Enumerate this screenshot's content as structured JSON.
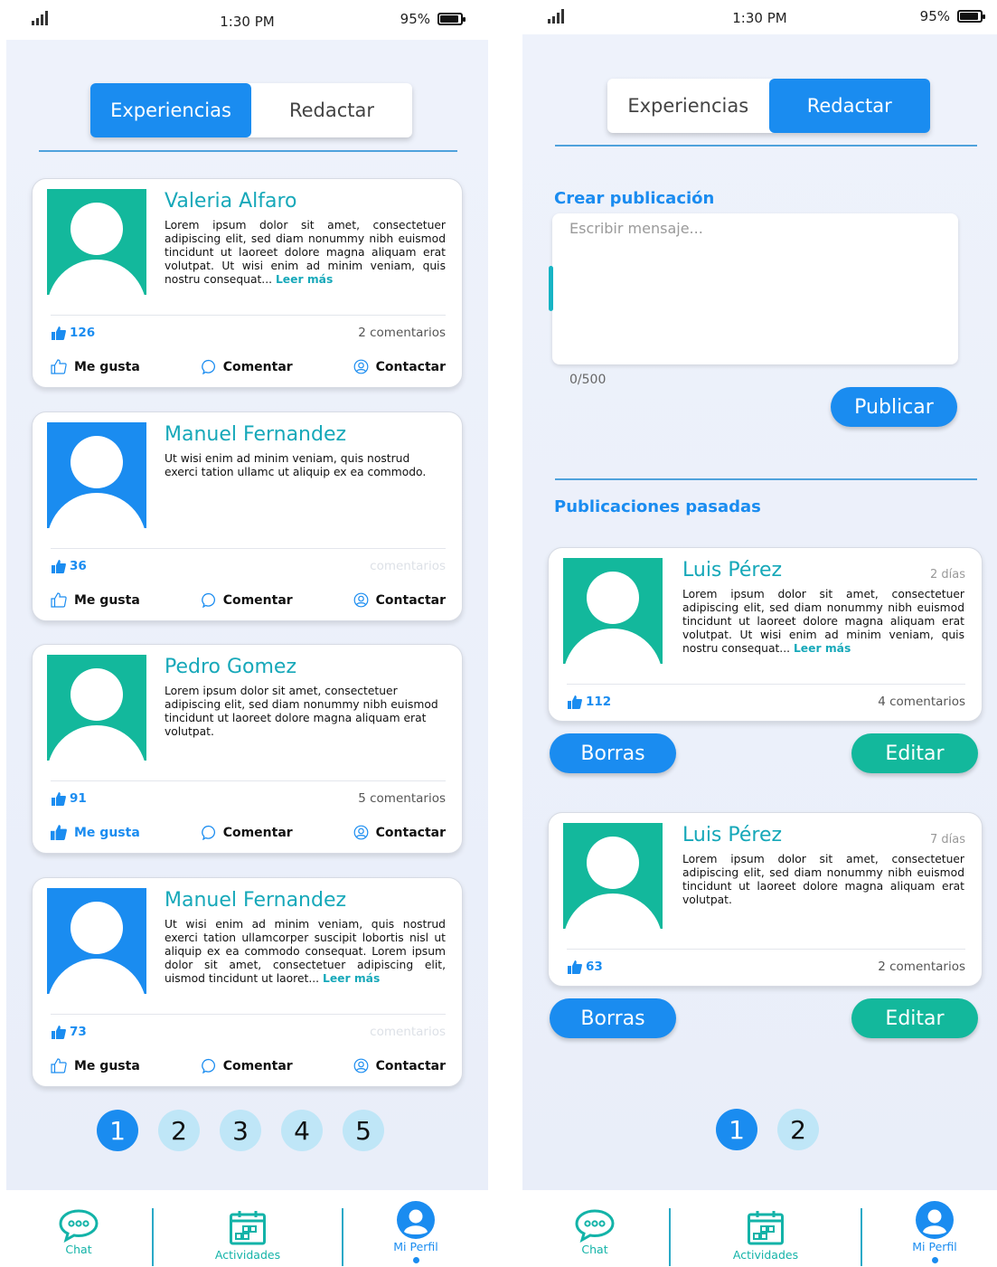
{
  "status": {
    "time": "1:30 PM",
    "battery": "95%"
  },
  "tabs": {
    "experiencias": "Experiencias",
    "redactar": "Redactar"
  },
  "feed": [
    {
      "name": "Valeria Alfaro",
      "text": "Lorem ipsum dolor sit amet, consectetuer adipiscing elit, sed diam nonummy nibh euismod tincidunt ut laoreet dolore magna aliquam erat volutpat. Ut wisi enim ad minim veniam, quis nostru consequat...",
      "more": "Leer más",
      "likes": "126",
      "comments": "2 comentarios",
      "avatar_color": "#13b89c",
      "liked": false
    },
    {
      "name": "Manuel Fernandez",
      "text": "Ut wisi enim ad minim veniam, quis nostrud exerci tation ullamc ut aliquip ex ea commodo.",
      "more": "",
      "likes": "36",
      "comments": "comentarios",
      "avatar_color": "#1a8cf0",
      "liked": false
    },
    {
      "name": "Pedro Gomez",
      "text": "Lorem ipsum dolor sit amet, consectetuer adipiscing elit, sed diam nonummy nibh euismod tincidunt ut laoreet dolore magna aliquam erat volutpat.",
      "more": "",
      "likes": "91",
      "comments": "5 comentarios",
      "avatar_color": "#13b89c",
      "liked": true
    },
    {
      "name": "Manuel Fernandez",
      "text": "Ut wisi enim ad minim veniam, quis nostrud exerci tation ullamcorper suscipit lobortis nisl ut aliquip ex ea commodo consequat. Lorem ipsum dolor sit amet, consectetuer adipiscing elit, uismod tincidunt ut laoret...",
      "more": "Leer más",
      "likes": "73",
      "comments": "comentarios",
      "avatar_color": "#1a8cf0",
      "liked": false
    }
  ],
  "actions": {
    "like": "Me gusta",
    "comment": "Comentar",
    "contact": "Contactar"
  },
  "pager1": [
    "1",
    "2",
    "3",
    "4",
    "5"
  ],
  "pager2": [
    "1",
    "2"
  ],
  "compose": {
    "title": "Crear publicación",
    "placeholder": "Escribir mensaje...",
    "counter": "0/500",
    "publish": "Publicar"
  },
  "past": {
    "title": "Publicaciones pasadas",
    "posts": [
      {
        "name": "Luis Pérez",
        "days": "2 días",
        "text": "Lorem ipsum dolor sit amet, consectetuer adipiscing elit, sed diam nonummy nibh euismod tincidunt ut laoreet dolore magna aliquam erat volutpat. Ut wisi enim ad minim veniam, quis nostru consequat...",
        "more": "Leer más",
        "likes": "112",
        "comments": "4 comentarios"
      },
      {
        "name": "Luis Pérez",
        "days": "7 días",
        "text": "Lorem ipsum dolor sit amet, consectetuer adipiscing elit, sed diam nonummy nibh euismod tincidunt ut laoreet dolore magna aliquam erat volutpat.",
        "more": "",
        "likes": "63",
        "comments": "2 comentarios"
      }
    ],
    "delete": "Borras",
    "edit": "Editar"
  },
  "nav": {
    "chat": "Chat",
    "activities": "Actividades",
    "profile": "Mi Perfil"
  }
}
